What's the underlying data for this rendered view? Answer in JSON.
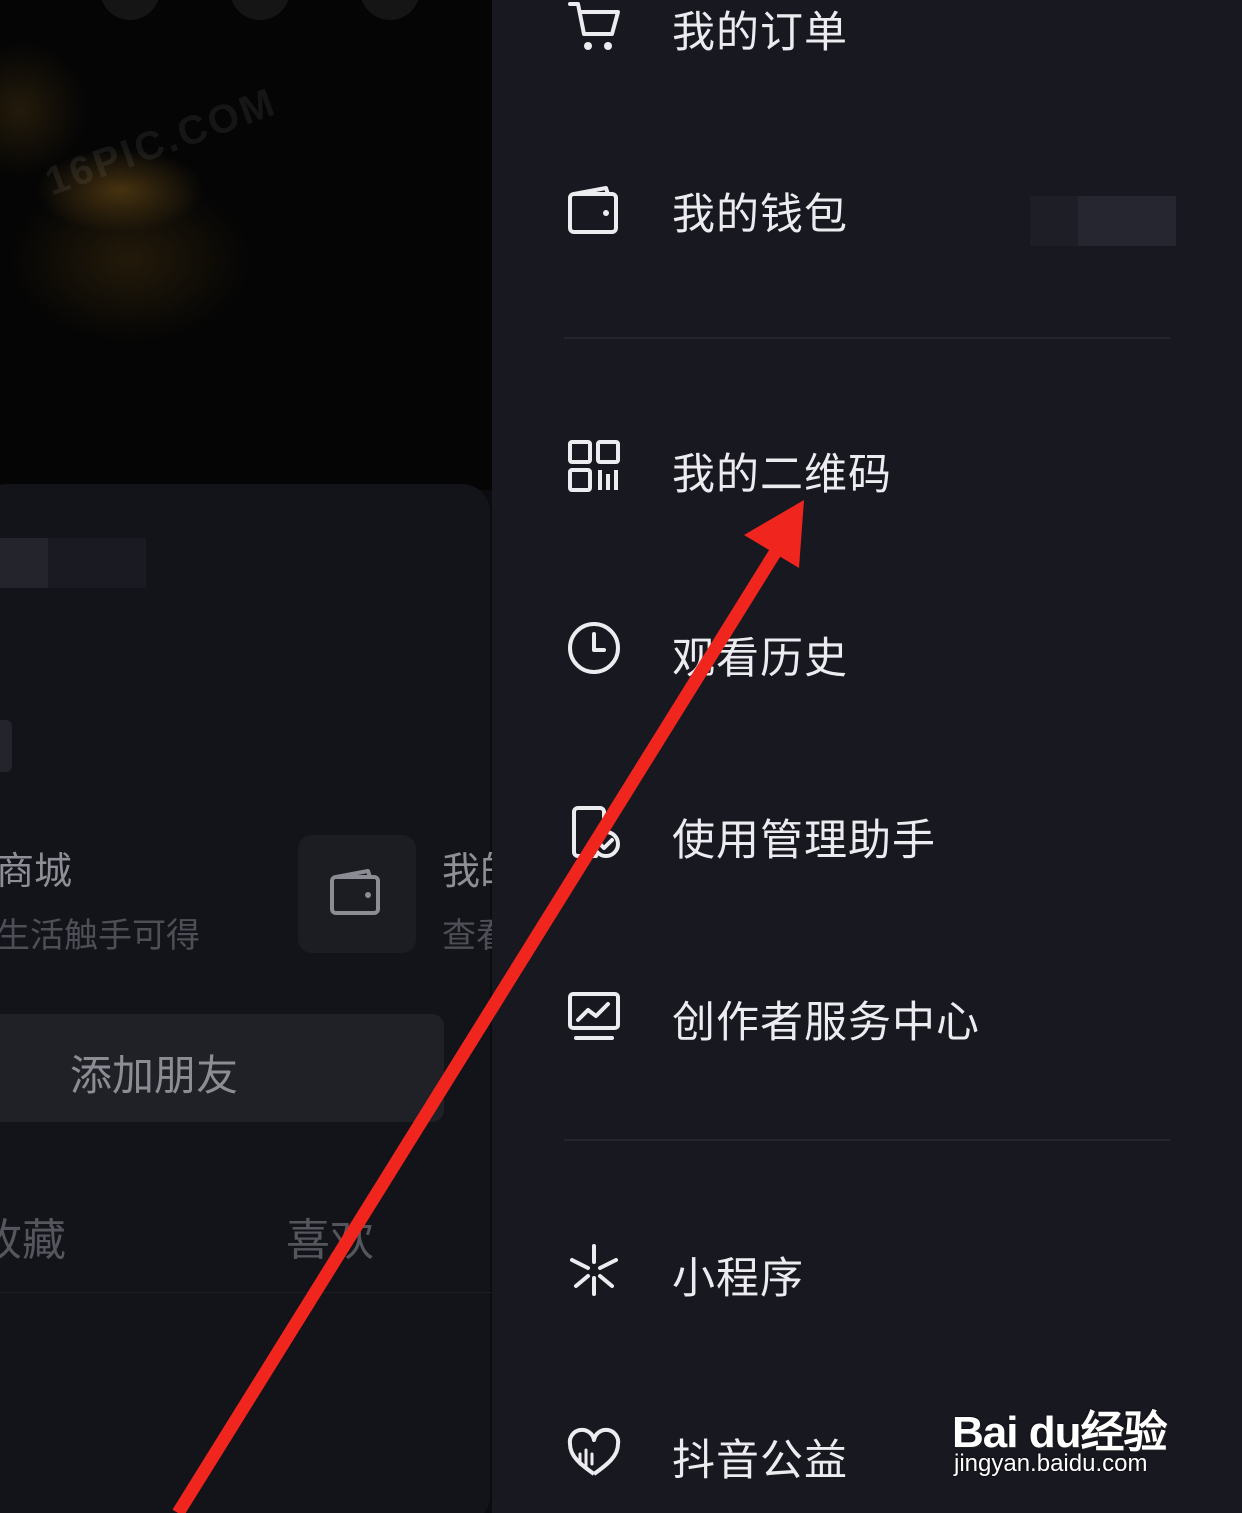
{
  "background_page": {
    "cover_watermark": "16PIC.COM",
    "mall": {
      "title": "商城",
      "subtitle": "生活触手可得"
    },
    "wallet": {
      "title": "我的",
      "subtitle": "查看"
    },
    "add_friend_label": "添加朋友",
    "tabs": [
      "收藏",
      "喜欢"
    ]
  },
  "drawer": {
    "items": [
      {
        "label": "我的订单",
        "icon": "cart-icon"
      },
      {
        "label": "我的钱包",
        "icon": "wallet-icon"
      },
      {
        "label": "我的二维码",
        "icon": "qr-code-icon"
      },
      {
        "label": "观看历史",
        "icon": "clock-icon"
      },
      {
        "label": "使用管理助手",
        "icon": "phone-check-icon"
      },
      {
        "label": "创作者服务中心",
        "icon": "monitor-chart-icon"
      },
      {
        "label": "小程序",
        "icon": "mini-program-icon"
      },
      {
        "label": "抖音公益",
        "icon": "heart-charity-icon"
      }
    ]
  },
  "annotation": {
    "arrow_color": "#f0261e",
    "target": "我的二维码"
  },
  "watermark": {
    "logo": "Bai du经验",
    "url": "jingyan.baidu.com"
  },
  "colors": {
    "drawer_bg": "#181821",
    "text": "#ececf0",
    "accent_red": "#f0261e"
  }
}
